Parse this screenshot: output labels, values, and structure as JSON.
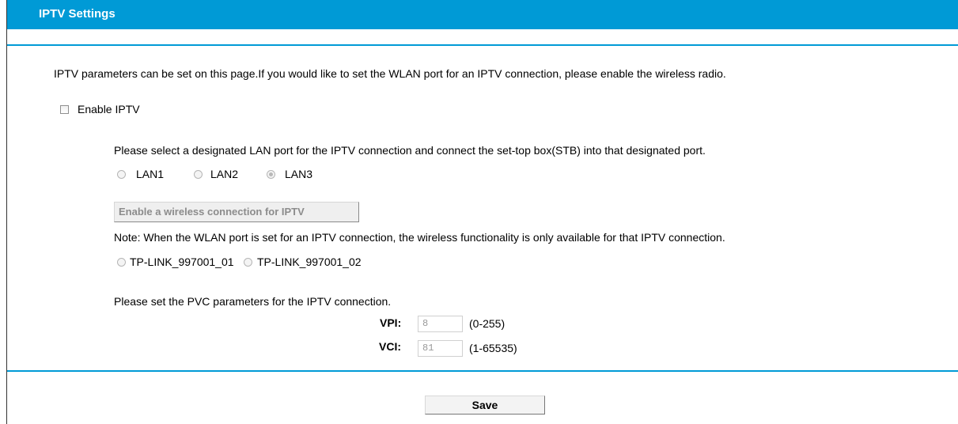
{
  "header": {
    "title": "IPTV Settings"
  },
  "intro": "IPTV parameters can be set on this page.If you would like to set the WLAN port for an IPTV connection, please enable the wireless radio.",
  "enable": {
    "label": "Enable IPTV",
    "checked": false
  },
  "lan": {
    "instruction": "Please select a designated LAN port for the IPTV connection and connect the set-top box(STB) into that designated port.",
    "options": [
      {
        "label": "LAN1",
        "checked": false
      },
      {
        "label": "LAN2",
        "checked": false
      },
      {
        "label": "LAN3",
        "checked": true
      }
    ]
  },
  "wireless": {
    "button_label": "Enable a wireless connection for IPTV",
    "note": "Note: When the WLAN port is set for an IPTV connection, the wireless functionality is only available for that IPTV connection.",
    "ssids": [
      {
        "label": "TP-LINK_997001_01",
        "checked": false
      },
      {
        "label": "TP-LINK_997001_02",
        "checked": false
      }
    ]
  },
  "pvc": {
    "instruction": "Please set the PVC parameters for the IPTV connection.",
    "vpi": {
      "label": "VPI:",
      "value": "8",
      "range": "(0-255)"
    },
    "vci": {
      "label": "VCI:",
      "value": "81",
      "range": "(1-65535)"
    }
  },
  "footer": {
    "save_label": "Save"
  },
  "colors": {
    "accent": "#009ad6"
  }
}
